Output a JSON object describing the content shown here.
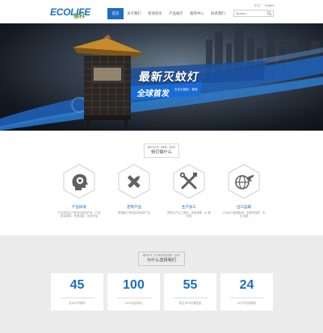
{
  "header": {
    "logo_text": "ECOLIFE",
    "logo_cn": "易科",
    "nav": [
      {
        "label": "首页",
        "active": true
      },
      {
        "label": "关于我们",
        "active": false
      },
      {
        "label": "新闻资讯",
        "active": false
      },
      {
        "label": "产品展示",
        "active": false
      },
      {
        "label": "服务中心",
        "active": false
      },
      {
        "label": "联系我们",
        "active": false
      }
    ],
    "lang": "中文 ｜ English",
    "search_placeholder": "Search..."
  },
  "banner": {
    "headline": "最新灭蚊灯",
    "sub_headline": "全球首发",
    "sub_small": "安全无辐射，静音",
    "slides": 3,
    "active_slide": 1
  },
  "services": {
    "title_en": "WHAT WE DO",
    "title_cn": "我们做什么",
    "items": [
      {
        "icon": "brain-gear-icon",
        "name": "产品研发",
        "desc": "专业研发生产各类灭蚊用产品，产品 质量保障，不断创新，安全环保"
      },
      {
        "icon": "pencil-ruler-icon",
        "name": "定制产品",
        "desc": "根据客户需求定制各类产品"
      },
      {
        "icon": "tools-icon",
        "name": "生产加工",
        "desc": "拥有生产加工基地，质量保障，价 格优惠"
      },
      {
        "icon": "globe-plane-icon",
        "name": "出口运输",
        "desc": "公司出口各国各地，质量有保障，安全 运输"
      }
    ]
  },
  "why": {
    "title_en": "WHY CHOOSE US",
    "title_cn": "为什么选择我们",
    "stats": [
      {
        "value": "45",
        "label": "天45小时服务"
      },
      {
        "value": "100",
        "label": "100%品质保证"
      },
      {
        "value": "55",
        "label": "超过55%的满意度"
      },
      {
        "value": "24",
        "label": "24小时全程服务"
      }
    ]
  },
  "colors": {
    "accent": "#1e6dc2",
    "green": "#5aa236",
    "section_bg": "#ececec",
    "icon_gray": "#666666"
  }
}
